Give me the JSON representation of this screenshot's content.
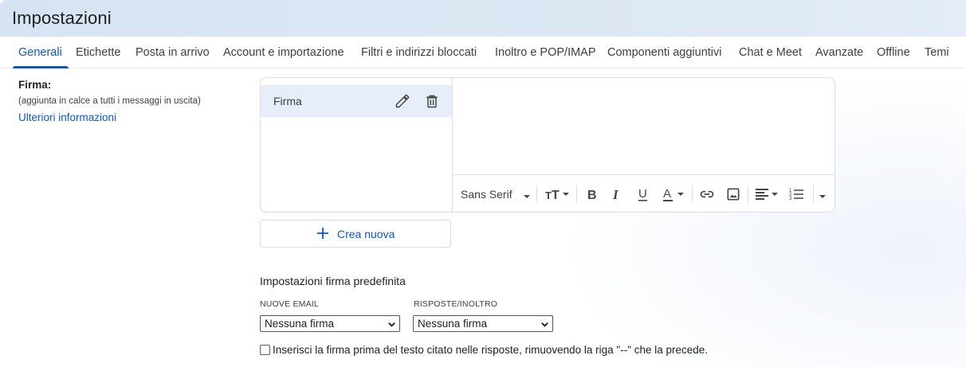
{
  "header": {
    "title": "Impostazioni"
  },
  "tabs": [
    {
      "label": "Generali",
      "active": true
    },
    {
      "label": "Etichette"
    },
    {
      "label": "Posta in arrivo"
    },
    {
      "label": "Account e importazione"
    },
    {
      "label": "Filtri e indirizzi bloccati"
    },
    {
      "label": "Inoltro e POP/IMAP"
    },
    {
      "label": "Componenti aggiuntivi"
    },
    {
      "label": "Chat e Meet"
    },
    {
      "label": "Avanzate"
    },
    {
      "label": "Offline"
    },
    {
      "label": "Temi"
    }
  ],
  "signature": {
    "label": "Firma:",
    "sublabel": "(aggiunta in calce a tutti i messaggi in uscita)",
    "learn_more": "Ulteriori informazioni",
    "items": [
      {
        "name": "Firma"
      }
    ],
    "create_new": "Crea nuova",
    "toolbar": {
      "font": "Sans Serif"
    }
  },
  "defaults": {
    "title": "Impostazioni firma predefinita",
    "new_email_label": "NUOVE EMAIL",
    "new_email_value": "Nessuna firma",
    "replies_label": "RISPOSTE/INOLTRO",
    "replies_value": "Nessuna firma",
    "insert_before_quote": "Inserisci la firma prima del testo citato nelle risposte, rimuovendo la riga \"--\" che la precede."
  },
  "colors": {
    "accent": "#0b57d0",
    "header_bg": "#dae6f4",
    "selected_bg": "#e7eefa"
  }
}
